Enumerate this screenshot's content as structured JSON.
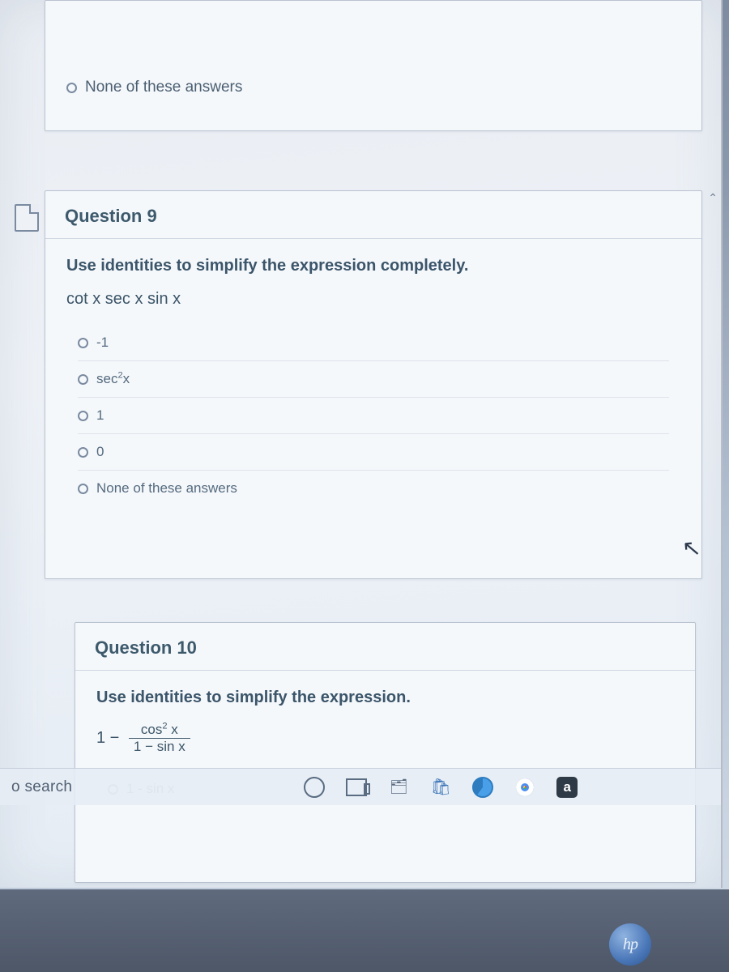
{
  "prev_question": {
    "option_none": "None of these answers"
  },
  "question9": {
    "title": "Question 9",
    "prompt": "Use identities to simplify the expression completely.",
    "expression": "cot x sec x sin x",
    "options": {
      "a": "-1",
      "b_prefix": "sec",
      "b_sup": "2",
      "b_suffix": "x",
      "c": "1",
      "d": "0",
      "e": "None of these answers"
    }
  },
  "question10": {
    "title": "Question 10",
    "prompt": "Use identities to simplify the expression.",
    "lead": "1 −",
    "num_prefix": "cos",
    "num_sup": "2",
    "num_suffix": " x",
    "den": "1 − sin x",
    "opt1": "1 - sin x"
  },
  "taskbar": {
    "search": "o search",
    "amazon": "a"
  },
  "hp": "hp"
}
